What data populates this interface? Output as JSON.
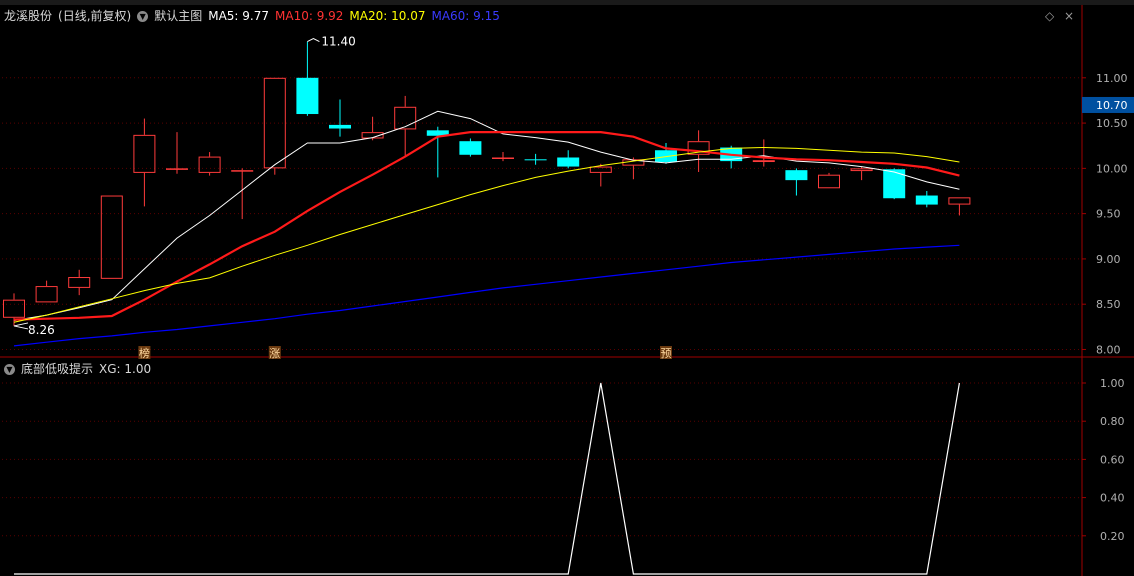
{
  "main_header": {
    "symbol": "龙溪股份",
    "period": "(日线,前复权)",
    "template": "默认主图",
    "ma5": "MA5: 9.77",
    "ma10": "MA10: 9.92",
    "ma20": "MA20: 10.07",
    "ma60": "MA60: 9.15"
  },
  "sub_header": {
    "indicator": "底部低吸提示",
    "value": "XG: 1.00"
  },
  "colors": {
    "up": "#ff3b3b",
    "down": "#00ffff",
    "ma5": "#ffffff",
    "ma10": "#ff1a1a",
    "ma20": "#ffff00",
    "ma60": "#0000ff",
    "axis": "#a00000",
    "grid": "#5a0000"
  },
  "chart_data": [
    {
      "type": "candlestick",
      "y_ticks": [
        "11.00",
        "10.50",
        "10.00",
        "9.50",
        "9.00",
        "8.50",
        "8.00"
      ],
      "ylim": [
        7.95,
        11.55
      ],
      "current_price_label": "10.70",
      "high_label": "11.40",
      "low_label": "8.26",
      "event_markers": [
        {
          "bar": 4,
          "text": "榜"
        },
        {
          "bar": 8,
          "text": "涨"
        },
        {
          "bar": 20,
          "text": "预"
        }
      ],
      "candles": [
        {
          "o": 8.35,
          "h": 8.62,
          "l": 8.26,
          "c": 8.55
        },
        {
          "o": 8.52,
          "h": 8.76,
          "l": 8.52,
          "c": 8.7
        },
        {
          "o": 8.68,
          "h": 8.88,
          "l": 8.6,
          "c": 8.8
        },
        {
          "o": 8.78,
          "h": 9.7,
          "l": 8.78,
          "c": 9.7
        },
        {
          "o": 9.95,
          "h": 10.55,
          "l": 9.58,
          "c": 10.37
        },
        {
          "o": 10.0,
          "h": 10.4,
          "l": 9.94,
          "c": 10.0
        },
        {
          "o": 9.95,
          "h": 10.18,
          "l": 9.92,
          "c": 10.13
        },
        {
          "o": 9.97,
          "h": 10.0,
          "l": 9.44,
          "c": 9.98
        },
        {
          "o": 10.0,
          "h": 11.0,
          "l": 9.93,
          "c": 11.0
        },
        {
          "o": 11.0,
          "h": 11.4,
          "l": 10.58,
          "c": 10.6
        },
        {
          "o": 10.48,
          "h": 10.76,
          "l": 10.35,
          "c": 10.44
        },
        {
          "o": 10.33,
          "h": 10.57,
          "l": 10.31,
          "c": 10.4
        },
        {
          "o": 10.43,
          "h": 10.8,
          "l": 10.13,
          "c": 10.68
        },
        {
          "o": 10.42,
          "h": 10.46,
          "l": 9.9,
          "c": 10.36
        },
        {
          "o": 10.3,
          "h": 10.33,
          "l": 10.13,
          "c": 10.15
        },
        {
          "o": 10.12,
          "h": 10.18,
          "l": 10.08,
          "c": 10.12
        },
        {
          "o": 10.1,
          "h": 10.16,
          "l": 10.04,
          "c": 10.09
        },
        {
          "o": 10.12,
          "h": 10.2,
          "l": 10.0,
          "c": 10.02
        },
        {
          "o": 9.95,
          "h": 10.05,
          "l": 9.8,
          "c": 10.02
        },
        {
          "o": 10.03,
          "h": 10.12,
          "l": 9.88,
          "c": 10.1
        },
        {
          "o": 10.2,
          "h": 10.28,
          "l": 10.05,
          "c": 10.07
        },
        {
          "o": 10.15,
          "h": 10.42,
          "l": 9.96,
          "c": 10.3
        },
        {
          "o": 10.23,
          "h": 10.25,
          "l": 10.0,
          "c": 10.08
        },
        {
          "o": 10.07,
          "h": 10.32,
          "l": 10.02,
          "c": 10.09
        },
        {
          "o": 9.98,
          "h": 10.0,
          "l": 9.7,
          "c": 9.87
        },
        {
          "o": 9.78,
          "h": 9.95,
          "l": 9.78,
          "c": 9.93
        },
        {
          "o": 9.97,
          "h": 10.02,
          "l": 9.87,
          "c": 10.0
        },
        {
          "o": 9.99,
          "h": 10.0,
          "l": 9.66,
          "c": 9.67
        },
        {
          "o": 9.7,
          "h": 9.75,
          "l": 9.57,
          "c": 9.6
        },
        {
          "o": 9.6,
          "h": 9.68,
          "l": 9.48,
          "c": 9.68
        }
      ],
      "series": [
        {
          "name": "MA5",
          "values": [
            8.32,
            8.38,
            8.46,
            8.55,
            8.89,
            9.23,
            9.48,
            9.76,
            10.04,
            10.28,
            10.28,
            10.34,
            10.46,
            10.63,
            10.55,
            10.38,
            10.34,
            10.29,
            10.18,
            10.09,
            10.06,
            10.1,
            10.1,
            10.14,
            10.08,
            10.06,
            10.02,
            9.96,
            9.85,
            9.77
          ]
        },
        {
          "name": "MA10",
          "values": [
            8.33,
            8.34,
            8.35,
            8.37,
            8.55,
            8.75,
            8.94,
            9.14,
            9.3,
            9.53,
            9.74,
            9.93,
            10.13,
            10.35,
            10.4,
            10.4,
            10.4,
            10.4,
            10.4,
            10.35,
            10.22,
            10.19,
            10.15,
            10.12,
            10.1,
            10.09,
            10.07,
            10.05,
            10.01,
            9.92
          ]
        },
        {
          "name": "MA20",
          "values": [
            8.3,
            8.38,
            8.47,
            8.56,
            8.65,
            8.73,
            8.79,
            8.92,
            9.04,
            9.15,
            9.27,
            9.38,
            9.49,
            9.6,
            9.71,
            9.81,
            9.9,
            9.97,
            10.03,
            10.08,
            10.13,
            10.18,
            10.22,
            10.23,
            10.22,
            10.2,
            10.18,
            10.17,
            10.13,
            10.07
          ]
        },
        {
          "name": "MA60",
          "values": [
            8.04,
            8.08,
            8.12,
            8.15,
            8.19,
            8.22,
            8.26,
            8.3,
            8.34,
            8.39,
            8.43,
            8.48,
            8.53,
            8.58,
            8.63,
            8.68,
            8.72,
            8.76,
            8.8,
            8.84,
            8.88,
            8.92,
            8.96,
            8.99,
            9.02,
            9.05,
            9.08,
            9.11,
            9.13,
            9.15
          ]
        }
      ]
    },
    {
      "type": "line",
      "y_ticks": [
        "1.00",
        "0.80",
        "0.60",
        "0.40",
        "0.20"
      ],
      "ylim": [
        0,
        1.0
      ],
      "series": [
        {
          "name": "XG",
          "values": [
            0,
            0,
            0,
            0,
            0,
            0,
            0,
            0,
            0,
            0,
            0,
            0,
            0,
            0,
            0,
            0,
            0,
            0,
            1,
            0,
            0,
            0,
            0,
            0,
            0,
            0,
            0,
            0,
            0,
            1
          ]
        }
      ]
    }
  ]
}
